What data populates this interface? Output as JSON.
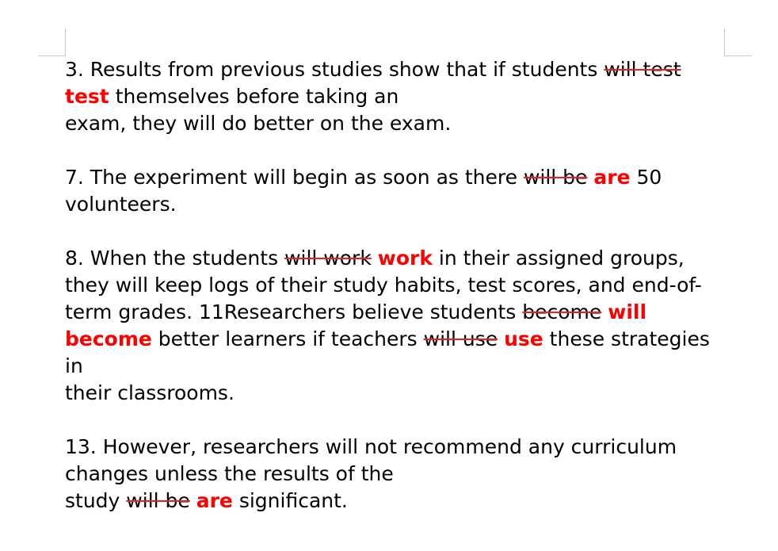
{
  "document": {
    "paragraphs": [
      {
        "lines": [
          [
            {
              "type": "text",
              "text": "3. Results from previous studies show that if students "
            },
            {
              "type": "del",
              "text": "will test"
            }
          ],
          [
            {
              "type": "ins",
              "text": "test"
            },
            {
              "type": "text",
              "text": " themselves before taking an"
            }
          ],
          [
            {
              "type": "text",
              "text": "exam, they will do better on the exam."
            }
          ]
        ]
      },
      {
        "lines": [
          [
            {
              "type": "text",
              "text": "7. The experiment will begin as soon as there "
            },
            {
              "type": "del",
              "text": "will be"
            },
            {
              "type": "text",
              "text": " "
            },
            {
              "type": "ins",
              "text": "are"
            },
            {
              "type": "text",
              "text": " 50"
            }
          ],
          [
            {
              "type": "text",
              "text": "volunteers."
            }
          ]
        ]
      },
      {
        "lines": [
          [
            {
              "type": "text",
              "text": "8. When the students "
            },
            {
              "type": "del",
              "text": "will work"
            },
            {
              "type": "text",
              "text": " "
            },
            {
              "type": "ins",
              "text": "work"
            },
            {
              "type": "text",
              "text": " in their assigned groups,"
            }
          ],
          [
            {
              "type": "text",
              "text": "they will keep logs of their study habits, test scores, and end-of-"
            }
          ],
          [
            {
              "type": "text",
              "text": "term grades. 11Researchers believe students "
            },
            {
              "type": "del",
              "text": "become"
            },
            {
              "type": "text",
              "text": " "
            },
            {
              "type": "ins",
              "text": "will"
            }
          ],
          [
            {
              "type": "ins",
              "text": "become"
            },
            {
              "type": "text",
              "text": " better learners if teachers "
            },
            {
              "type": "del",
              "text": "will use"
            },
            {
              "type": "text",
              "text": " "
            },
            {
              "type": "ins",
              "text": "use"
            },
            {
              "type": "text",
              "text": " these strategies in"
            }
          ],
          [
            {
              "type": "text",
              "text": "their classrooms."
            }
          ]
        ]
      },
      {
        "lines": [
          [
            {
              "type": "text",
              "text": "13. However, researchers will not recommend any curriculum"
            }
          ],
          [
            {
              "type": "text",
              "text": "changes unless the results of the"
            }
          ],
          [
            {
              "type": "text",
              "text": "study "
            },
            {
              "type": "del",
              "text": "will be"
            },
            {
              "type": "text",
              "text": " "
            },
            {
              "type": "ins",
              "text": "are"
            },
            {
              "type": "text",
              "text": " significant."
            }
          ]
        ]
      }
    ]
  },
  "colors": {
    "insertion": "#ff0000",
    "deletion_strike": "#e8231c",
    "text": "#000000"
  }
}
